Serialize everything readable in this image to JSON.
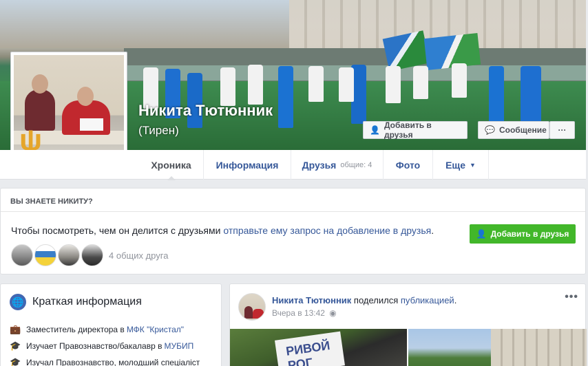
{
  "profile": {
    "name": "Никита Тютюнник",
    "nickname": "(Тирен)"
  },
  "cover_buttons": {
    "add_friend": "Добавить в друзья",
    "message": "Сообщение",
    "more": "···"
  },
  "nav": {
    "tabs": [
      {
        "label": "Хроника"
      },
      {
        "label": "Информация"
      },
      {
        "label": "Друзья",
        "count": "общие: 4"
      },
      {
        "label": "Фото"
      },
      {
        "label": "Еще"
      }
    ]
  },
  "know_card": {
    "header": "ВЫ ЗНАЕТЕ НИКИТУ?",
    "text": "Чтобы посмотреть, чем он делится с друзьями",
    "link": "отправьте ему запрос на добавление в друзья",
    "button": "Добавить в друзья",
    "mutual_friends": "4 общих друга"
  },
  "intro": {
    "title": "Краткая информация",
    "rows": [
      {
        "icon": "briefcase-icon",
        "text": "Заместитель директора в ",
        "link": "МФК \"Кристал\""
      },
      {
        "icon": "graduation-cap-icon",
        "text": "Изучает Правознавство/бакалавр в ",
        "link": "МУБИП"
      },
      {
        "icon": "graduation-cap-icon",
        "text": "Изучал Правознавство, молодший спеціаліст",
        "link": ""
      }
    ]
  },
  "post": {
    "author": "Никита Тютюнник",
    "action": " поделился ",
    "object": "публикацией",
    "period": ".",
    "time": "Вчера в 13:42",
    "more": "•••",
    "image_sign": "РИВОЙ РОГ"
  },
  "colors": {
    "link": "#365899",
    "green_button": "#42b72a",
    "background": "#e9ebee"
  }
}
